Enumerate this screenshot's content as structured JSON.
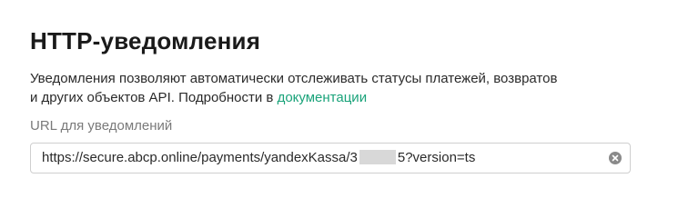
{
  "section": {
    "title": "HTTP-уведомления",
    "description_line1": "Уведомления позволяют автоматически отслеживать статусы платежей, возвратов",
    "description_line2_prefix": "и других объектов API. Подробности в ",
    "docs_link": "документации"
  },
  "url_field": {
    "label": "URL для уведомлений",
    "value_prefix": "https://secure.abcp.online/payments/yandexKassa/3",
    "value_suffix": "5?version=ts",
    "clear_icon": "clear-circle-icon"
  },
  "colors": {
    "link": "#1aa37a",
    "label": "#7a7a7a",
    "border": "#cfcfcf"
  }
}
